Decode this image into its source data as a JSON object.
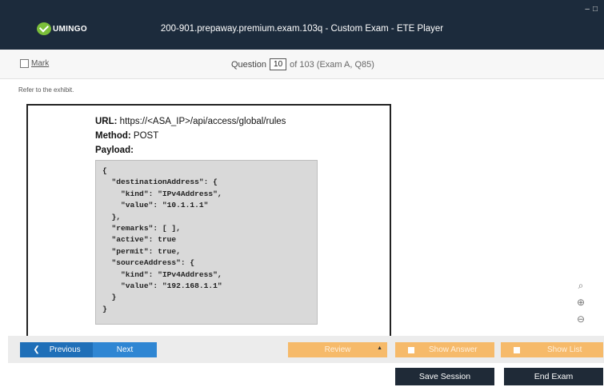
{
  "titlebar": {
    "logo_text": "UMINGO",
    "title": "200-901.prepaway.premium.exam.103q - Custom Exam - ETE Player",
    "minimize": "–",
    "maximize": "□"
  },
  "question_bar": {
    "mark_label": "Mark",
    "question_prefix": "Question",
    "question_number": "10",
    "question_suffix": "of 103 (Exam A, Q85)"
  },
  "content": {
    "refer_text": "Refer to the exhibit.",
    "exhibit": {
      "url_label": "URL:",
      "url_value": "https://<ASA_IP>/api/access/global/rules",
      "method_label": "Method:",
      "method_value": "POST",
      "payload_label": "Payload:",
      "payload_code": "{\n  \"destinationAddress\": {\n    \"kind\": \"IPv4Address\",\n    \"value\": \"10.1.1.1\"\n  },\n  \"remarks\": [ ],\n  \"active\": true\n  \"permit\": true,\n  \"sourceAddress\": {\n    \"kind\": \"IPv4Address\",\n    \"value\": \"192.168.1.1\"\n  }\n}"
    }
  },
  "zoom": {
    "search_icon": "search-icon",
    "zoom_in_icon": "zoom-in-icon",
    "zoom_out_icon": "zoom-out-icon"
  },
  "nav": {
    "previous": "Previous",
    "next": "Next",
    "review": "Review",
    "show_answer": "Show Answer",
    "show_list": "Show List"
  },
  "footer": {
    "save_session": "Save Session",
    "end_exam": "End Exam"
  },
  "colors": {
    "titlebar_bg": "#1c2b3c",
    "primary_blue": "#1f6fb8",
    "orange": "#f6ba6a",
    "dark_button": "#1f2a37"
  }
}
